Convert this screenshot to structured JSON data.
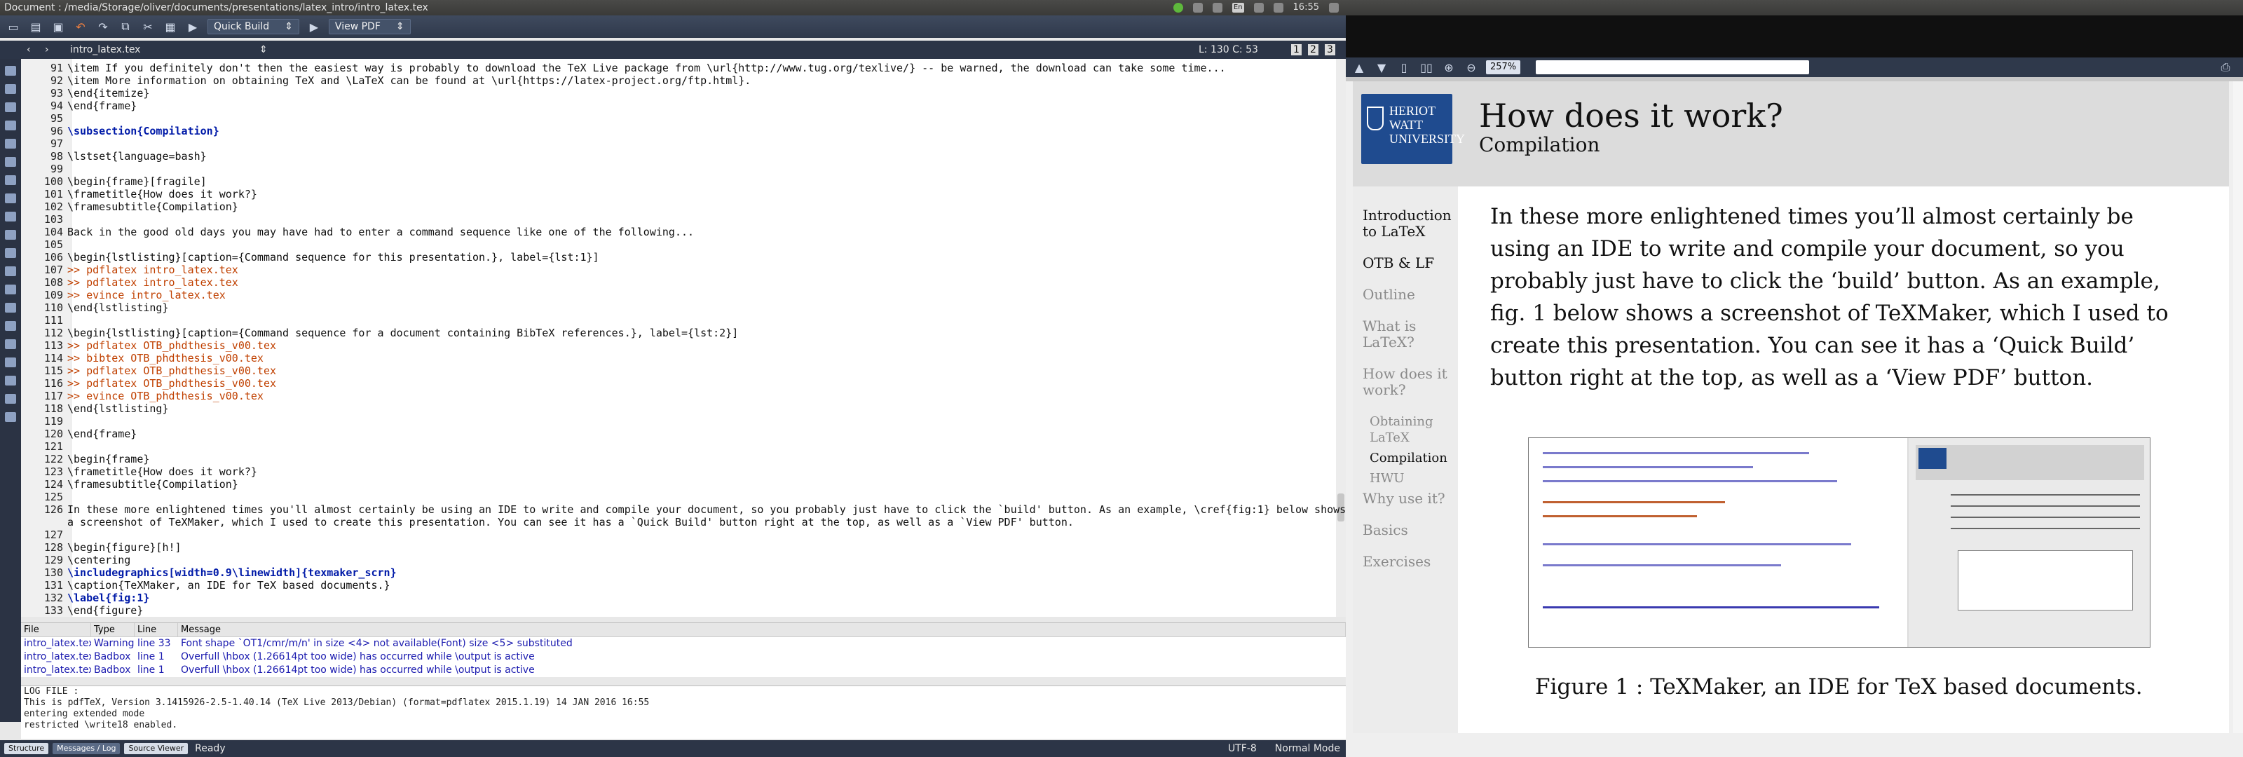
{
  "window": {
    "title": "Document : /media/Storage/oliver/documents/presentations/latex_intro/intro_latex.tex",
    "clock": "16:55",
    "keyboard": "En"
  },
  "toolbar": {
    "quick_build": "Quick Build",
    "view_pdf": "View PDF"
  },
  "tab": {
    "filename": "intro_latex.tex",
    "position": "L: 130 C: 53",
    "views": [
      "1",
      "2",
      "3"
    ]
  },
  "editor": {
    "lines": [
      {
        "n": "91",
        "t": "\\item If you definitely don't then the easiest way is probably to download the TeX Live package from \\url{http://www.tug.org/texlive/} -- be warned, the download can take some time..."
      },
      {
        "n": "92",
        "t": "\\item More information on obtaining TeX and \\LaTeX can be found at \\url{https://latex-project.org/ftp.html}."
      },
      {
        "n": "93",
        "t": "\\end{itemize}"
      },
      {
        "n": "94",
        "t": "\\end{frame}"
      },
      {
        "n": "95",
        "t": ""
      },
      {
        "n": "96",
        "t": "\\subsection{Compilation}"
      },
      {
        "n": "97",
        "t": ""
      },
      {
        "n": "98",
        "t": "\\lstset{language=bash}"
      },
      {
        "n": "99",
        "t": ""
      },
      {
        "n": "100",
        "t": "\\begin{frame}[fragile]"
      },
      {
        "n": "101",
        "t": "\\frametitle{How does it work?}"
      },
      {
        "n": "102",
        "t": "\\framesubtitle{Compilation}"
      },
      {
        "n": "103",
        "t": ""
      },
      {
        "n": "104",
        "t": "Back in the good old days you may have had to enter a command sequence like one of the following..."
      },
      {
        "n": "105",
        "t": ""
      },
      {
        "n": "106",
        "t": "\\begin{lstlisting}[caption={Command sequence for this presentation.}, label={lst:1}]"
      },
      {
        "n": "107",
        "t": ">> pdflatex intro_latex.tex"
      },
      {
        "n": "108",
        "t": ">> pdflatex intro_latex.tex"
      },
      {
        "n": "109",
        "t": ">> evince intro_latex.tex"
      },
      {
        "n": "110",
        "t": "\\end{lstlisting}"
      },
      {
        "n": "111",
        "t": ""
      },
      {
        "n": "112",
        "t": "\\begin{lstlisting}[caption={Command sequence for a document containing BibTeX references.}, label={lst:2}]"
      },
      {
        "n": "113",
        "t": ">> pdflatex OTB_phdthesis_v00.tex"
      },
      {
        "n": "114",
        "t": ">> bibtex OTB_phdthesis_v00.tex"
      },
      {
        "n": "115",
        "t": ">> pdflatex OTB_phdthesis_v00.tex"
      },
      {
        "n": "116",
        "t": ">> pdflatex OTB_phdthesis_v00.tex"
      },
      {
        "n": "117",
        "t": ">> evince OTB_phdthesis_v00.tex"
      },
      {
        "n": "118",
        "t": "\\end{lstlisting}"
      },
      {
        "n": "119",
        "t": ""
      },
      {
        "n": "120",
        "t": "\\end{frame}"
      },
      {
        "n": "121",
        "t": ""
      },
      {
        "n": "122",
        "t": "\\begin{frame}"
      },
      {
        "n": "123",
        "t": "\\frametitle{How does it work?}"
      },
      {
        "n": "124",
        "t": "\\framesubtitle{Compilation}"
      },
      {
        "n": "125",
        "t": ""
      },
      {
        "n": "126",
        "t": "In these more enlightened times you'll almost certainly be using an IDE to write and compile your document, so you probably just have to click the `build' button. As an example, \\cref{fig:1} below shows"
      },
      {
        "n": "",
        "t": "a screenshot of TeXMaker, which I used to create this presentation. You can see it has a `Quick Build' button right at the top, as well as a `View PDF' button."
      },
      {
        "n": "127",
        "t": ""
      },
      {
        "n": "128",
        "t": "\\begin{figure}[h!]"
      },
      {
        "n": "129",
        "t": "\\centering"
      },
      {
        "n": "130",
        "t": "\\includegraphics[width=0.9\\linewidth]{texmaker_scrn}"
      },
      {
        "n": "131",
        "t": "\\caption{TeXMaker, an IDE for TeX based documents.}"
      },
      {
        "n": "132",
        "t": "\\label{fig:1}"
      },
      {
        "n": "133",
        "t": "\\end{figure}"
      },
      {
        "n": "134",
        "t": ""
      }
    ]
  },
  "messages": {
    "headers": [
      "File",
      "Type",
      "Line",
      "Message"
    ],
    "rows": [
      [
        "intro_latex.tex",
        "Warning",
        "line 33",
        "Font shape `OT1/cmr/m/n' in size <4> not available(Font) size <5> substituted"
      ],
      [
        "intro_latex.tex",
        "Badbox",
        "line 1",
        "Overfull \\hbox (1.26614pt too wide) has occurred while \\output is active"
      ],
      [
        "intro_latex.tex",
        "Badbox",
        "line 1",
        "Overfull \\hbox (1.26614pt too wide) has occurred while \\output is active"
      ]
    ]
  },
  "log": {
    "lines": [
      "LOG FILE :",
      "This is pdfTeX, Version 3.1415926-2.5-1.40.14 (TeX Live 2013/Debian) (format=pdflatex 2015.1.19) 14 JAN 2016 16:55",
      "entering extended mode",
      "restricted \\write18 enabled."
    ]
  },
  "status": {
    "tabs": [
      "Structure",
      "Messages / Log",
      "Source Viewer"
    ],
    "ready": "Ready",
    "encoding": "UTF-8",
    "mode": "Normal Mode"
  },
  "viewer": {
    "zoom": "257%"
  },
  "slide": {
    "logo": "HERIOT WATT UNIVERSITY",
    "title": "How does it work?",
    "subtitle": "Compilation",
    "nav": [
      {
        "label": "Introduction to LaTeX",
        "state": "current"
      },
      {
        "label": "OTB & LF",
        "state": "current"
      },
      {
        "label": "Outline",
        "state": "dim"
      },
      {
        "label": "What is LaTeX?",
        "state": "dim"
      },
      {
        "label": "How does it work?",
        "state": "dim"
      },
      {
        "label": "Obtaining LaTeX",
        "state": "sub"
      },
      {
        "label": "Compilation",
        "state": "subcur"
      },
      {
        "label": "HWU",
        "state": "sub"
      },
      {
        "label": "Why use it?",
        "state": "dim"
      },
      {
        "label": "Basics",
        "state": "dim"
      },
      {
        "label": "Exercises",
        "state": "dim"
      }
    ],
    "body": "In these more enlightened times you’ll almost certainly be using an IDE to write and compile your document, so you probably just have to click the ‘build’ button. As an example, fig. 1 below shows a screenshot of TeXMaker, which I used to create this presentation. You can see it has a ‘Quick Build’ button right at the top, as well as a ‘View PDF’ button.",
    "caption": "Figure 1 :   TeXMaker, an IDE for TeX based documents."
  }
}
